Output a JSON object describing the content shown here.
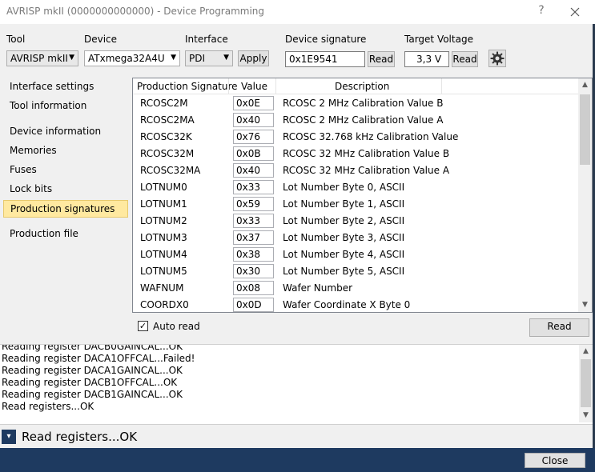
{
  "window": {
    "title": "AVRISP mkII (0000000000000) - Device Programming",
    "help_glyph": "?",
    "close_glyph": "×"
  },
  "toolbar": {
    "tool_label": "Tool",
    "tool_value": "AVRISP mkII",
    "device_label": "Device",
    "device_value": "ATxmega32A4U",
    "interface_label": "Interface",
    "interface_value": "PDI",
    "apply_label": "Apply",
    "signature_label": "Device signature",
    "signature_value": "0x1E9541",
    "signature_read_label": "Read",
    "voltage_label": "Target Voltage",
    "voltage_value": "3,3 V",
    "voltage_read_label": "Read",
    "settings_icon": "gear-icon"
  },
  "sidebar": {
    "items": [
      {
        "label": "Interface settings"
      },
      {
        "label": "Tool information"
      },
      {
        "label": "Device information"
      },
      {
        "label": "Memories"
      },
      {
        "label": "Fuses"
      },
      {
        "label": "Lock bits"
      },
      {
        "label": "Production signatures"
      },
      {
        "label": "Production file"
      }
    ],
    "active": "Production signatures"
  },
  "table": {
    "columns": [
      "Production Signature",
      "Value",
      "Description"
    ],
    "rows": [
      {
        "name": "RCOSC2M",
        "value": "0x0E",
        "desc": "RCOSC 2 MHz Calibration Value B"
      },
      {
        "name": "RCOSC2MA",
        "value": "0x40",
        "desc": "RCOSC 2 MHz Calibration Value A"
      },
      {
        "name": "RCOSC32K",
        "value": "0x76",
        "desc": "RCOSC 32.768 kHz Calibration Value"
      },
      {
        "name": "RCOSC32M",
        "value": "0x0B",
        "desc": "RCOSC 32 MHz Calibration Value B"
      },
      {
        "name": "RCOSC32MA",
        "value": "0x40",
        "desc": "RCOSC 32 MHz Calibration Value A"
      },
      {
        "name": "LOTNUM0",
        "value": "0x33",
        "desc": "Lot Number Byte 0, ASCII"
      },
      {
        "name": "LOTNUM1",
        "value": "0x59",
        "desc": "Lot Number Byte 1, ASCII"
      },
      {
        "name": "LOTNUM2",
        "value": "0x33",
        "desc": "Lot Number Byte 2, ASCII"
      },
      {
        "name": "LOTNUM3",
        "value": "0x37",
        "desc": "Lot Number Byte 3, ASCII"
      },
      {
        "name": "LOTNUM4",
        "value": "0x38",
        "desc": "Lot Number Byte 4, ASCII"
      },
      {
        "name": "LOTNUM5",
        "value": "0x30",
        "desc": "Lot Number Byte 5, ASCII"
      },
      {
        "name": "WAFNUM",
        "value": "0x08",
        "desc": "Wafer Number"
      },
      {
        "name": "COORDX0",
        "value": "0x0D",
        "desc": "Wafer Coordinate X Byte 0"
      }
    ]
  },
  "autoread": {
    "label": "Auto read",
    "checked": true,
    "check_glyph": "✓"
  },
  "read_button": {
    "label": "Read"
  },
  "log": {
    "lines": [
      "Reading register DACB0GAINCAL...OK",
      "Reading register DACA1OFFCAL...Failed!",
      "Reading register DACA1GAINCAL...OK",
      "Reading register DACB1OFFCAL...OK",
      "Reading register DACB1GAINCAL...OK",
      "Read registers...OK"
    ]
  },
  "status": {
    "text": "Read registers...OK",
    "toggle_glyph": "▾"
  },
  "footer": {
    "close_label": "Close"
  }
}
